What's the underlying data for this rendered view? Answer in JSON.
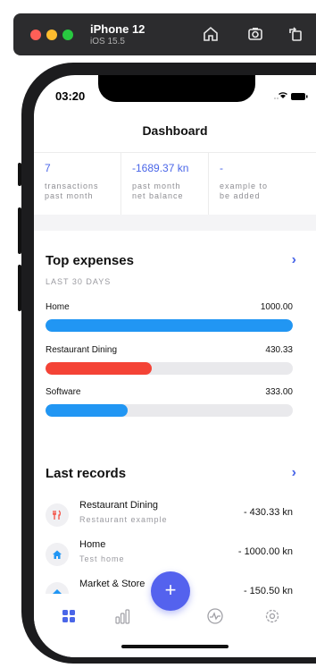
{
  "simulator": {
    "device_name": "iPhone 12",
    "os_version": "iOS 15.5",
    "icons": [
      "home-icon",
      "screenshot-icon",
      "rotate-icon"
    ]
  },
  "status_bar": {
    "time": "03:20"
  },
  "header": {
    "title": "Dashboard"
  },
  "stats": [
    {
      "value": "7",
      "label_line1": "transactions",
      "label_line2": "past month"
    },
    {
      "value": "-1689.37 kn",
      "label_line1": "past month",
      "label_line2": "net balance"
    },
    {
      "value": "-",
      "label_line1": "example to",
      "label_line2": "be added"
    }
  ],
  "top_expenses": {
    "title": "Top expenses",
    "subtitle": "LAST 30 DAYS",
    "items": [
      {
        "name": "Home",
        "value": "1000.00",
        "fraction": 1.0,
        "color": "#2196f3"
      },
      {
        "name": "Restaurant Dining",
        "value": "430.33",
        "fraction": 0.43,
        "color": "#f44336"
      },
      {
        "name": "Software",
        "value": "333.00",
        "fraction": 0.333,
        "color": "#2196f3"
      }
    ]
  },
  "last_records": {
    "title": "Last records",
    "items": [
      {
        "name": "Restaurant Dining",
        "description": "Restaurant example",
        "amount": "- 430.33 kn",
        "icon": "fork-knife-icon",
        "icon_color": "#f44336"
      },
      {
        "name": "Home",
        "description": "Test home",
        "amount": "- 1000.00 kn",
        "icon": "home-icon",
        "icon_color": "#2196f3"
      },
      {
        "name": "Market & Store",
        "description": "",
        "amount": "- 150.50 kn",
        "icon": "cart-icon",
        "icon_color": "#2196f3"
      }
    ]
  },
  "bottom_nav": {
    "items": [
      "dashboard-icon",
      "chart-icon",
      "activity-icon",
      "settings-icon"
    ],
    "active": "dashboard-icon",
    "fab_label": "+"
  },
  "colors": {
    "accent": "#4a66e8",
    "fab": "#5462ee"
  }
}
